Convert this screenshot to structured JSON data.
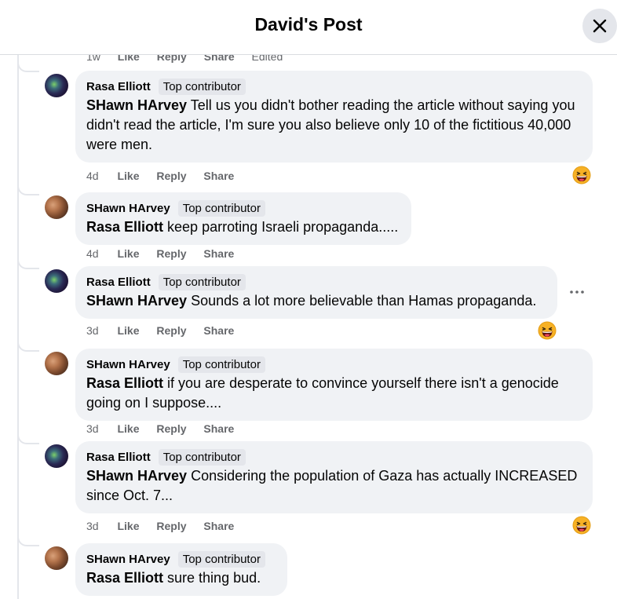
{
  "header": {
    "title": "David's Post",
    "close_icon": "close-icon"
  },
  "previous_actions": {
    "time": "1w",
    "like": "Like",
    "reply": "Reply",
    "share": "Share",
    "edited": "Edited"
  },
  "action_labels": {
    "like": "Like",
    "reply": "Reply",
    "share": "Share"
  },
  "comments": [
    {
      "author": "Rasa Elliott",
      "badge": "Top contributor",
      "mention": "SHawn HArvey",
      "text": " Tell us you didn't bother reading the article without saying you didn't read the article, I'm sure you also believe only 10 of the fictitious 40,000 were men.",
      "time": "4d",
      "reaction": "laughing-emoji"
    },
    {
      "author": "SHawn HArvey",
      "badge": "Top contributor",
      "mention": "Rasa Elliott",
      "text": " keep parroting Israeli propaganda.....",
      "time": "4d"
    },
    {
      "author": "Rasa Elliott",
      "badge": "Top contributor",
      "mention": "SHawn HArvey",
      "text": " Sounds a lot more believable than Hamas propaganda.",
      "time": "3d",
      "reaction": "laughing-emoji",
      "more": "..."
    },
    {
      "author": "SHawn HArvey",
      "badge": "Top contributor",
      "mention": "Rasa Elliott",
      "text": " if you are desperate to convince yourself there isn't a genocide going on I suppose....",
      "time": "3d"
    },
    {
      "author": "Rasa Elliott",
      "badge": "Top contributor",
      "mention": "SHawn HArvey",
      "text": " Considering the population of Gaza has actually INCREASED since Oct. 7...",
      "time": "3d",
      "reaction": "laughing-emoji"
    },
    {
      "author": "SHawn HArvey",
      "badge": "Top contributor",
      "mention": "Rasa Elliott",
      "text": " sure thing bud."
    }
  ]
}
